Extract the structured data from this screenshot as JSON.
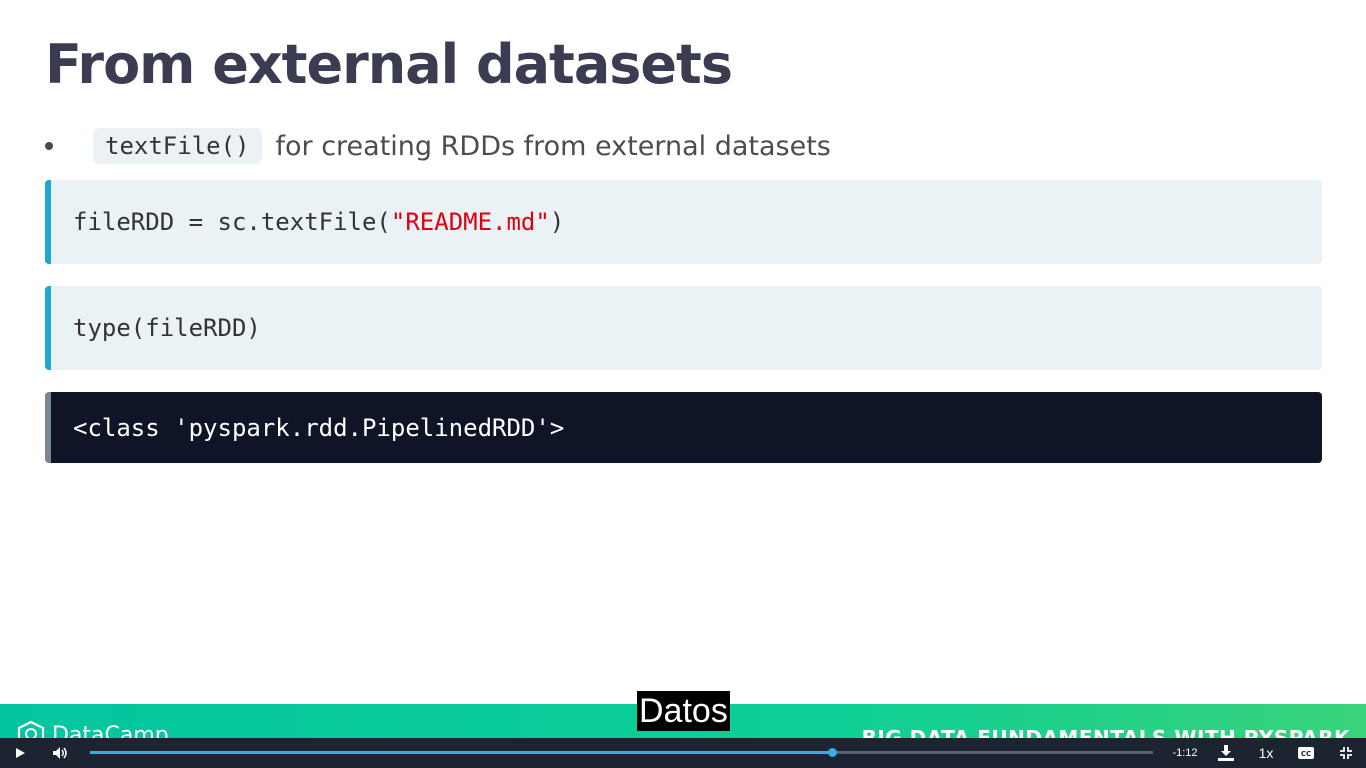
{
  "slide": {
    "title": "From external datasets",
    "bullet": {
      "code": "textFile()",
      "text": "for creating RDDs from external datasets"
    },
    "code1": {
      "prefix": "fileRDD = sc.textFile(",
      "string": "\"README.md\"",
      "suffix": ")"
    },
    "code2": "type(fileRDD)",
    "output": "<class 'pyspark.rdd.PipelinedRDD'>",
    "colors": {
      "title": "#3b3c52",
      "string": "#e0000e",
      "code_accent": "#1ba8d2",
      "output_bg": "#101427"
    }
  },
  "footer": {
    "brand": "DataCamp",
    "course": "BIG DATA FUNDAMENTALS WITH PYSPARK"
  },
  "caption": "Datos",
  "player": {
    "time_remaining": "-1:12",
    "speed": "1x",
    "progress": 0.698,
    "icons": [
      "play-icon",
      "volume-icon",
      "download-icon",
      "captions-icon",
      "exit-fullscreen-icon"
    ]
  }
}
